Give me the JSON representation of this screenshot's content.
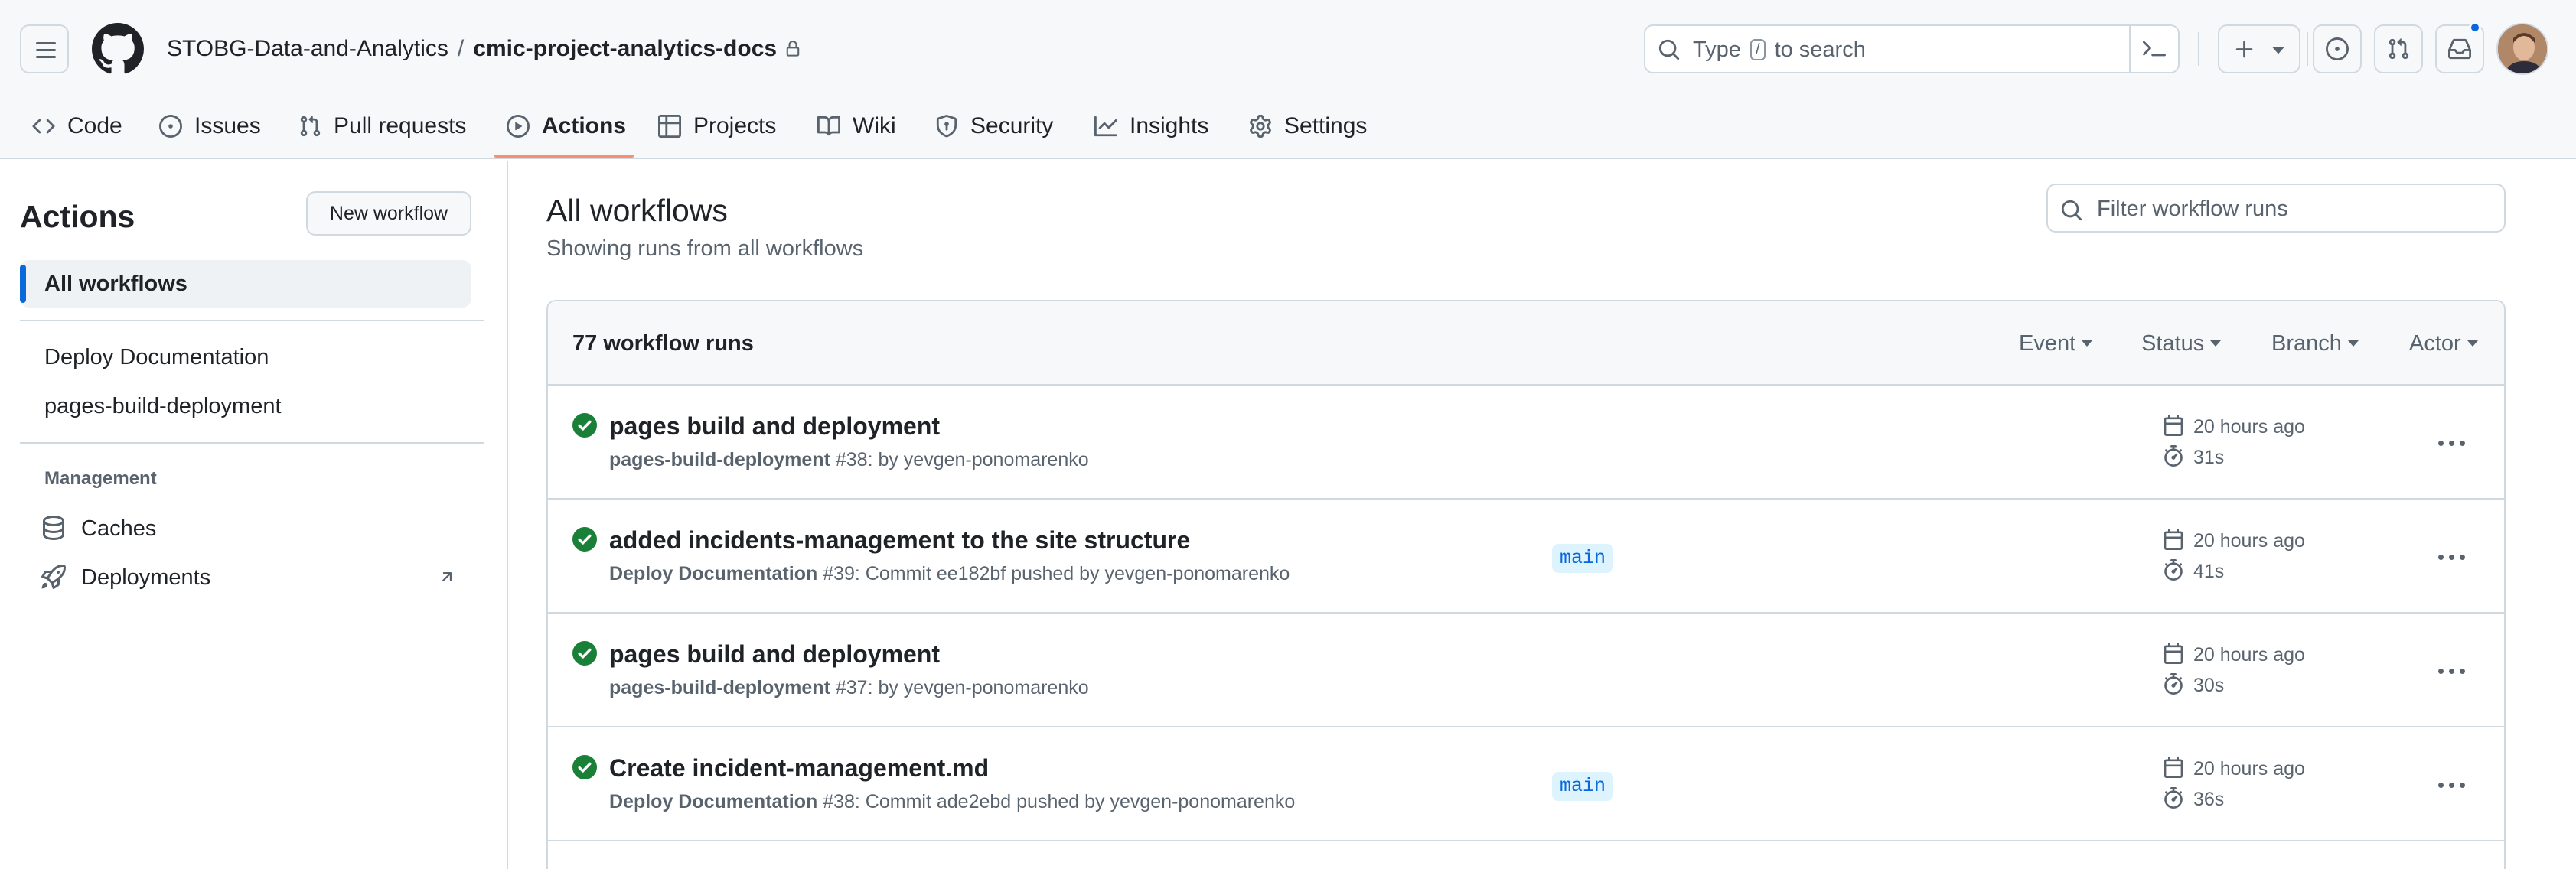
{
  "header": {
    "owner": "STOBG-Data-and-Analytics",
    "separator": "/",
    "repo": "cmic-project-analytics-docs",
    "search_prefix": "Type",
    "search_key": "/",
    "search_suffix": "to search"
  },
  "tabs": [
    {
      "label": "Code",
      "icon": "code-icon"
    },
    {
      "label": "Issues",
      "icon": "issue-opened-icon"
    },
    {
      "label": "Pull requests",
      "icon": "git-pull-request-icon"
    },
    {
      "label": "Actions",
      "icon": "play-icon",
      "active": true
    },
    {
      "label": "Projects",
      "icon": "table-icon"
    },
    {
      "label": "Wiki",
      "icon": "book-icon"
    },
    {
      "label": "Security",
      "icon": "shield-icon"
    },
    {
      "label": "Insights",
      "icon": "graph-icon"
    },
    {
      "label": "Settings",
      "icon": "gear-icon"
    }
  ],
  "sidebar": {
    "title": "Actions",
    "new_workflow": "New workflow",
    "all_workflows": "All workflows",
    "workflows": [
      "Deploy Documentation",
      "pages-build-deployment"
    ],
    "management_heading": "Management",
    "caches": "Caches",
    "deployments": "Deployments"
  },
  "main": {
    "title": "All workflows",
    "subtitle": "Showing runs from all workflows",
    "filter_placeholder": "Filter workflow runs",
    "run_count": "77 workflow runs",
    "filters": [
      "Event",
      "Status",
      "Branch",
      "Actor"
    ],
    "runs": [
      {
        "title": "pages build and deployment",
        "workflow": "pages-build-deployment",
        "detail": "#38: by yevgen-ponomarenko",
        "branch": "",
        "time": "20 hours ago",
        "duration": "31s",
        "status": "success"
      },
      {
        "title": "added incidents-management to the site structure",
        "workflow": "Deploy Documentation",
        "detail": "#39: Commit ee182bf pushed by yevgen-ponomarenko",
        "branch": "main",
        "time": "20 hours ago",
        "duration": "41s",
        "status": "success"
      },
      {
        "title": "pages build and deployment",
        "workflow": "pages-build-deployment",
        "detail": "#37: by yevgen-ponomarenko",
        "branch": "",
        "time": "20 hours ago",
        "duration": "30s",
        "status": "success"
      },
      {
        "title": "Create incident-management.md",
        "workflow": "Deploy Documentation",
        "detail": "#38: Commit ade2ebd pushed by yevgen-ponomarenko",
        "branch": "main",
        "time": "20 hours ago",
        "duration": "36s",
        "status": "success"
      }
    ]
  },
  "colors": {
    "success": "#1a7f37",
    "accent": "#0969da",
    "tab_underline": "#fd8c73",
    "branch_bg": "#ddf4ff"
  }
}
